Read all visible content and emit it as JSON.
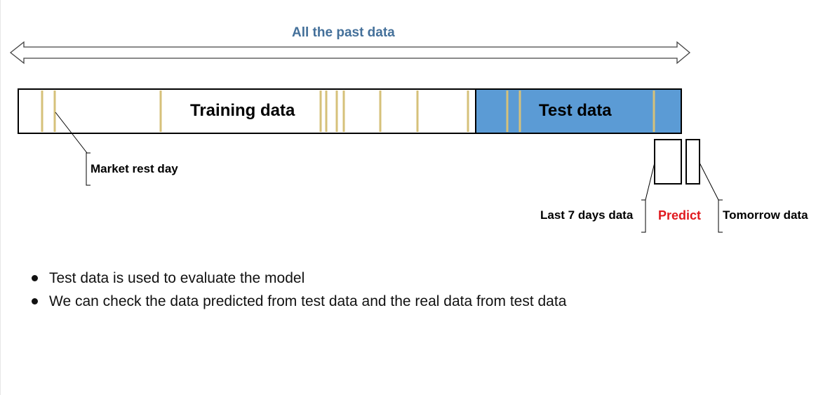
{
  "diagram": {
    "title": "All the past data",
    "training_label": "Training data",
    "test_label": "Test data",
    "market_rest_label": "Market rest day",
    "last7_label": "Last 7 days data",
    "predict_label": "Predict",
    "tomorrow_label": "Tomorrow data"
  },
  "bullets": [
    "Test data is used to evaluate the model",
    "We can check the data predicted from test data and the real data from test data"
  ],
  "colors": {
    "title": "#44709a",
    "test_fill": "#5b9bd5",
    "rest_day_line": "#d6c17a",
    "predict": "#e0191e"
  }
}
